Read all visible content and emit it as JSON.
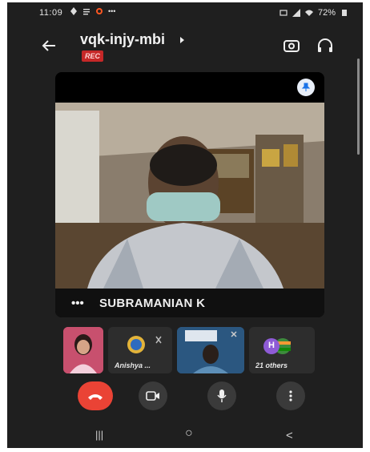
{
  "status_bar": {
    "time": "11:09",
    "battery": "72%"
  },
  "header": {
    "meeting_code": "vqk-injy-mbi",
    "rec_badge": "REC"
  },
  "main_tile": {
    "participant_name": "SUBRAMANIAN K",
    "more_label": "•••"
  },
  "thumbnails": [
    {
      "label": ""
    },
    {
      "label": "Anishya ..."
    },
    {
      "label": ""
    },
    {
      "label": "21 others",
      "avatar_initial": "H"
    }
  ],
  "nav": {
    "recents": "|||",
    "home": "○",
    "back": "<"
  },
  "colors": {
    "end_call": "#ea4335",
    "rec": "#c62828",
    "background": "#1f1f1f"
  }
}
